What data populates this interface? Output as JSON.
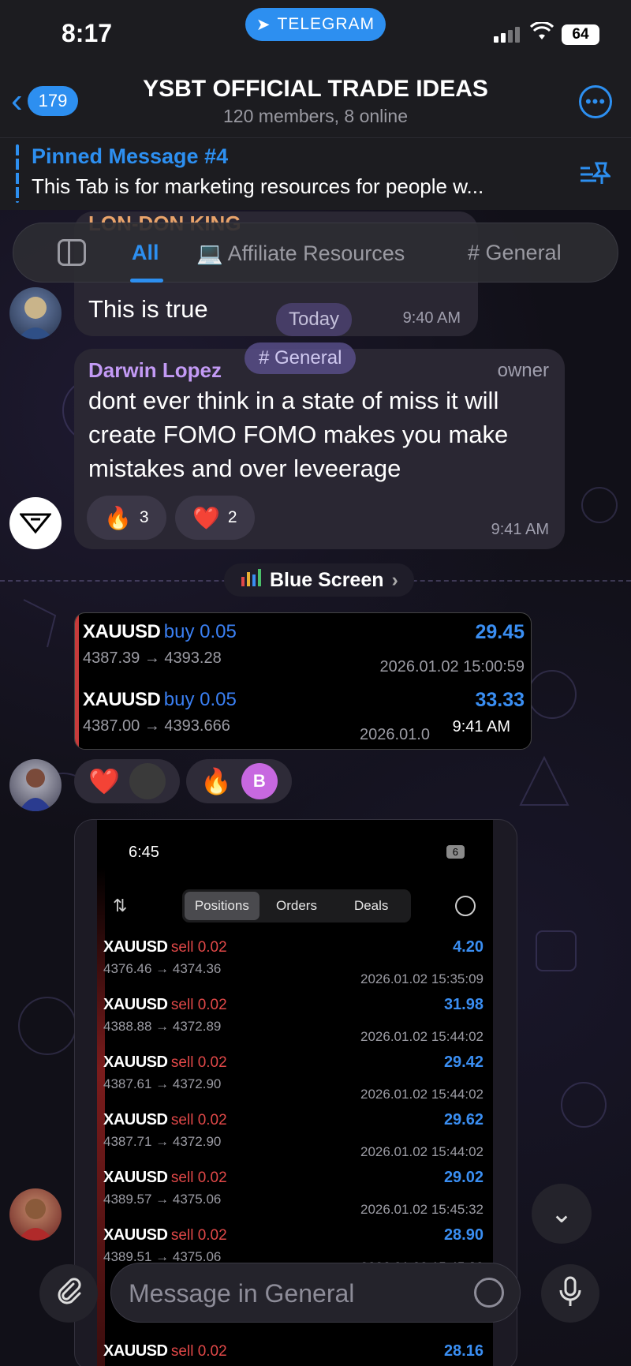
{
  "status_bar": {
    "time": "8:17",
    "app_pill": "TELEGRAM",
    "battery": "64"
  },
  "header": {
    "back_count": "179",
    "title": "YSBT OFFICIAL TRADE IDEAS",
    "subtitle": "120 members, 8 online"
  },
  "pinned": {
    "title": "Pinned Message #4",
    "text": "This Tab is for marketing resources for people w..."
  },
  "tabs": [
    {
      "label": "All"
    },
    {
      "label": "💻 Affiliate Resources"
    },
    {
      "label": "# General"
    }
  ],
  "messages": {
    "m1": {
      "cut_name": "LON-DON KING",
      "text": "This is true",
      "time": "9:40 AM"
    },
    "today_pill": "Today",
    "m2": {
      "name": "Darwin Lopez",
      "role": "owner",
      "text": "dont ever think in a state of miss it will create FOMO FOMO makes you make mistakes and over leveerage",
      "time": "9:41 AM",
      "reactions": [
        {
          "emoji": "🔥",
          "count": "3"
        },
        {
          "emoji": "❤️",
          "count": "2"
        }
      ]
    },
    "general_pill": "# General",
    "topic_pill": "Blue Screen",
    "trade_card": {
      "time": "9:41 AM",
      "rows": [
        {
          "symbol": "XAUUSD",
          "dir": "buy 0.05",
          "pnl": "29.45",
          "prices": "4387.39 → 4393.28",
          "date": "2026.01.02 15:00:59"
        },
        {
          "symbol": "XAUUSD",
          "dir": "buy 0.05",
          "pnl": "33.33",
          "prices": "4387.00 → 4393.666",
          "date": "2026.01.0"
        }
      ]
    },
    "reactions2": [
      {
        "emoji": "❤️"
      },
      {
        "emoji": "🔥",
        "avatar_letter": "B"
      }
    ],
    "screenshot": {
      "time": "6:45",
      "battery": "6",
      "tabs": [
        "Positions",
        "Orders",
        "Deals"
      ],
      "rows": [
        {
          "symbol": "XAUUSD",
          "dir": "sell 0.02",
          "pnl": "4.20",
          "prices": "4376.46 → 4374.36",
          "date": "2026.01.02 15:35:09"
        },
        {
          "symbol": "XAUUSD",
          "dir": "sell 0.02",
          "pnl": "31.98",
          "prices": "4388.88 → 4372.89",
          "date": "2026.01.02 15:44:02"
        },
        {
          "symbol": "XAUUSD",
          "dir": "sell 0.02",
          "pnl": "29.42",
          "prices": "4387.61 → 4372.90",
          "date": "2026.01.02 15:44:02"
        },
        {
          "symbol": "XAUUSD",
          "dir": "sell 0.02",
          "pnl": "29.62",
          "prices": "4387.71 → 4372.90",
          "date": "2026.01.02 15:44:02"
        },
        {
          "symbol": "XAUUSD",
          "dir": "sell 0.02",
          "pnl": "29.02",
          "prices": "4389.57 → 4375.06",
          "date": "2026.01.02 15:45:32"
        },
        {
          "symbol": "XAUUSD",
          "dir": "sell 0.02",
          "pnl": "28.90",
          "prices": "4389.51 → 4375.06",
          "date": "2026.01.02 15:45:32"
        },
        {
          "symbol": "XAUUSD",
          "dir": "sell 0.02",
          "pnl": "28.16",
          "prices": "",
          "date": ""
        }
      ]
    }
  },
  "composer": {
    "placeholder": "Message in General"
  },
  "colors": {
    "accent": "#2d8ff0",
    "owner_name": "#c39af5",
    "sell": "#e04848",
    "profit": "#3a8ef2"
  }
}
